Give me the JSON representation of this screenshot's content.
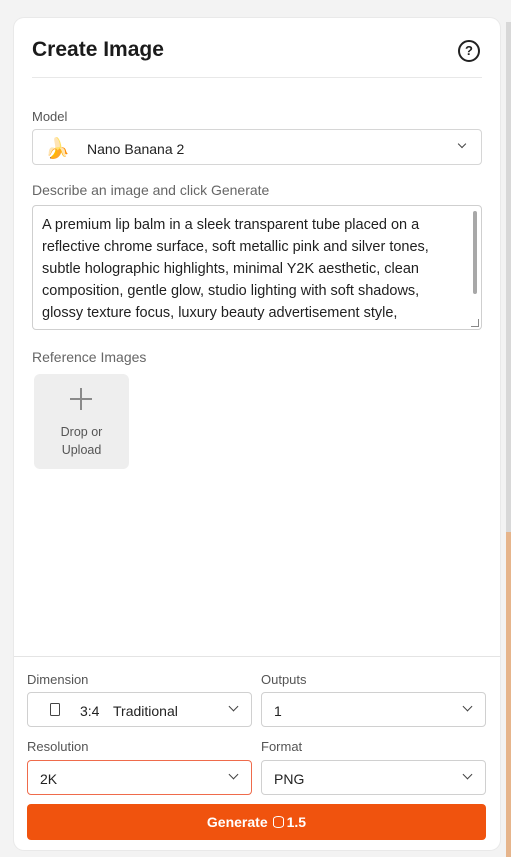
{
  "header": {
    "title": "Create Image",
    "help_icon": "?"
  },
  "model": {
    "label": "Model",
    "icon": "🍌",
    "value": "Nano Banana 2"
  },
  "prompt": {
    "label": "Describe an image and click Generate",
    "value": "A premium lip balm in a sleek transparent tube placed on a reflective chrome surface, soft metallic pink and silver tones, subtle holographic highlights, minimal Y2K aesthetic, clean composition, gentle glow, studio lighting with soft shadows, glossy texture focus, luxury beauty advertisement style,"
  },
  "reference": {
    "label": "Reference Images",
    "upload_line1": "Drop or",
    "upload_line2": "Upload"
  },
  "settings": {
    "dimension": {
      "label": "Dimension",
      "ratio": "3:4",
      "name": "Traditional"
    },
    "outputs": {
      "label": "Outputs",
      "value": "1"
    },
    "resolution": {
      "label": "Resolution",
      "value": "2K"
    },
    "format": {
      "label": "Format",
      "value": "PNG"
    }
  },
  "generate": {
    "label": "Generate",
    "cost": "1.5"
  },
  "colors": {
    "accent": "#f0530e",
    "active_border": "#ef6b4b"
  }
}
